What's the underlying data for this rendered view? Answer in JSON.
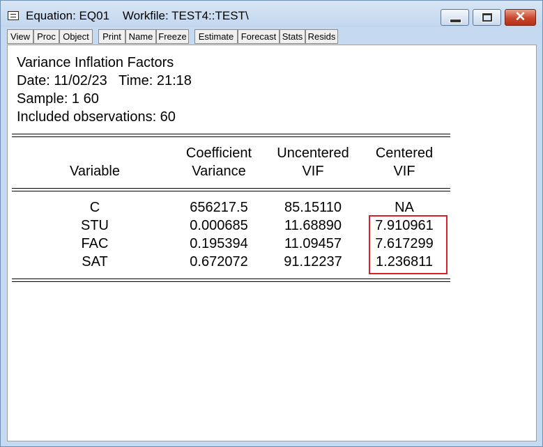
{
  "window": {
    "title": "Equation: EQ01    Workfile: TEST4::TEST\\",
    "close_glyph": "✕"
  },
  "toolbar": [
    "View",
    "Proc",
    "Object",
    "Print",
    "Name",
    "Freeze",
    "Estimate",
    "Forecast",
    "Stats",
    "Resids"
  ],
  "report": {
    "heading": "Variance Inflation Factors",
    "date_line": "Date: 11/02/23   Time: 21:18",
    "sample_line": "Sample: 1 60",
    "obs_line": "Included observations: 60"
  },
  "table": {
    "headers": {
      "variable": "Variable",
      "coef_variance_1": "Coefficient",
      "coef_variance_2": "Variance",
      "uncentered_1": "Uncentered",
      "uncentered_2": "VIF",
      "centered_1": "Centered",
      "centered_2": "VIF"
    },
    "rows": [
      {
        "variable": "C",
        "coef_variance": "656217.5",
        "uncentered_vif": "85.15110",
        "centered_vif": "NA"
      },
      {
        "variable": "STU",
        "coef_variance": "0.000685",
        "uncentered_vif": "11.68890",
        "centered_vif": "7.910961"
      },
      {
        "variable": "FAC",
        "coef_variance": "0.195394",
        "uncentered_vif": "11.09457",
        "centered_vif": "7.617299"
      },
      {
        "variable": "SAT",
        "coef_variance": "0.672072",
        "uncentered_vif": "91.12237",
        "centered_vif": "1.236811"
      }
    ]
  },
  "colors": {
    "highlight_box": "#d9202a",
    "window_frame": "#c5daf0"
  }
}
